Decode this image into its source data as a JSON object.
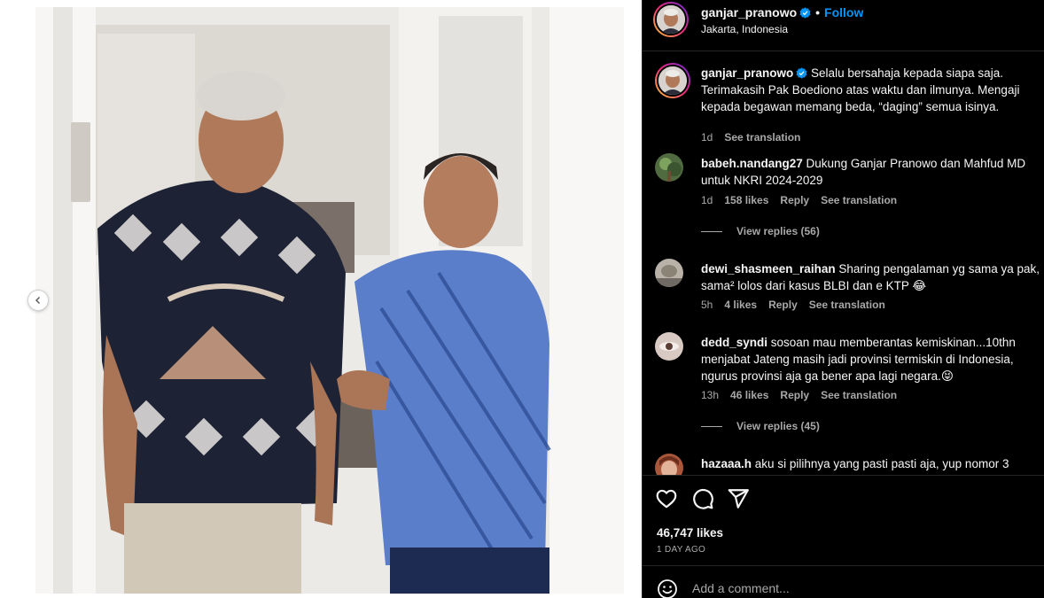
{
  "post": {
    "username": "ganjar_pranowo",
    "follow_label": "Follow",
    "dot": "•",
    "location": "Jakarta, Indonesia",
    "likes": "46,747 likes",
    "time_ago": "1 DAY AGO",
    "comment_placeholder": "Add a comment..."
  },
  "caption": {
    "username": "ganjar_pranowo",
    "text": "Selalu bersahaja kepada siapa saja. Terimakasih Pak Boediono atas waktu dan ilmunya. Mengaji kepada begawan memang beda, “daging” semua isinya.",
    "age": "1d",
    "see_translation": "See translation"
  },
  "comments": [
    {
      "username": "babeh.nandang27",
      "text": "Dukung Ganjar Pranowo dan Mahfud MD untuk NKRI 2024-2029",
      "age": "1d",
      "likes": "158 likes",
      "reply": "Reply",
      "see_translation": "See translation",
      "view_replies": "View replies (56)"
    },
    {
      "username": "dewi_shasmeen_raihan",
      "text": "Sharing pengalaman yg sama ya pak, sama² lolos dari kasus BLBI dan e KTP 😂",
      "age": "5h",
      "likes": "4 likes",
      "reply": "Reply",
      "see_translation": "See translation"
    },
    {
      "username": "dedd_syndi",
      "text": "sosoan mau memberantas kemiskinan...10thn menjabat Jateng masih jadi provinsi termiskin di Indonesia, ngurus provinsi aja ga bener apa lagi negara.😝",
      "age": "13h",
      "likes": "46 likes",
      "reply": "Reply",
      "see_translation": "See translation",
      "view_replies": "View replies (45)"
    },
    {
      "username": "hazaaa.h",
      "text": "aku si pilihnya yang pasti pasti aja, yup nomor 3"
    }
  ],
  "icons": {
    "verified": "verified-badge-icon",
    "like": "heart-icon",
    "comment": "comment-bubble-icon",
    "share": "paper-plane-icon",
    "emoji": "smiley-icon",
    "prev": "chevron-left-icon"
  },
  "colors": {
    "background": "#000000",
    "text": "#f5f5f5",
    "muted": "#a8a8a8",
    "accent": "#0095f6",
    "divider": "#262626"
  }
}
